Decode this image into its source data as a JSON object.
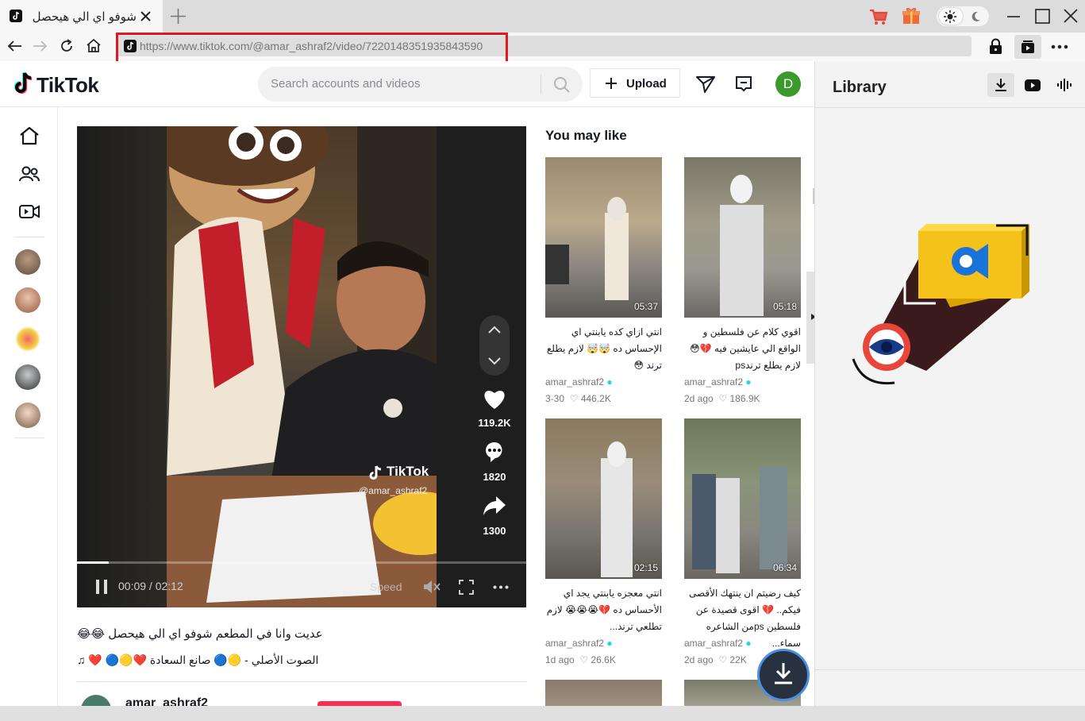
{
  "browser": {
    "tab_title": "شوفو اي الي هيحصل",
    "url": "https://www.tiktok.com/@amar_ashraf2/video/7220148351935843590"
  },
  "tiktok": {
    "logo": "TikTok",
    "search_placeholder": "Search accounts and videos",
    "upload_label": "Upload",
    "user_initial": "D"
  },
  "video": {
    "likes": "119.2K",
    "comments": "1820",
    "shares": "1300",
    "time": "00:09 / 02:12",
    "progress": 0.07,
    "speed_label": "Speed",
    "watermark_brand": "TikTok",
    "watermark_user": "@amar_ashraf2",
    "caption": "عديت وانا في المطعم شوفو اي الي هيحصل 😂😂",
    "music": "الصوت الأصلي - 🟡🔵 صانع السعادة ❤️🟡🔵 ❤️",
    "author": "amar_ashraf2"
  },
  "you_may_like": {
    "title": "You may like",
    "cards": [
      {
        "title": "انتي ازاي كده يابنتي اي الإحساس ده 🤯🤯 لازم يطلع ترند 😳",
        "duration": "05:37",
        "author": "amar_ashraf2",
        "age": "3-30",
        "likes": "446.2K"
      },
      {
        "title": "اقوي كلام عن فلسطين و الواقع الي عايشين فيه 💔😳 لازم يطلع ترندps",
        "duration": "05:18",
        "author": "amar_ashraf2",
        "age": "2d ago",
        "likes": "186.9K"
      },
      {
        "title": "انتي معجزه يابنتي يجد اي الأحساس ده 💔😭😭😭 لازم تطلعي ترند...",
        "duration": "02:15",
        "author": "amar_ashraf2",
        "age": "1d ago",
        "likes": "26.6K"
      },
      {
        "title": "كيف رضيتم ان ينتهك الأقصى فيكم.. 💔 اقوى قصيدة عن فلسطين psمن الشاعره سماء...",
        "duration": "06:34",
        "author": "amar_ashraf2",
        "age": "2d ago",
        "likes": "22K"
      }
    ]
  },
  "library": {
    "title": "Library"
  },
  "colors": {
    "url_highlight": "#e5171e",
    "tiktok_red": "#fe2c55",
    "avatar_green": "#3c9a2c",
    "verified": "#20d5ec",
    "cart": "#e8463a"
  }
}
